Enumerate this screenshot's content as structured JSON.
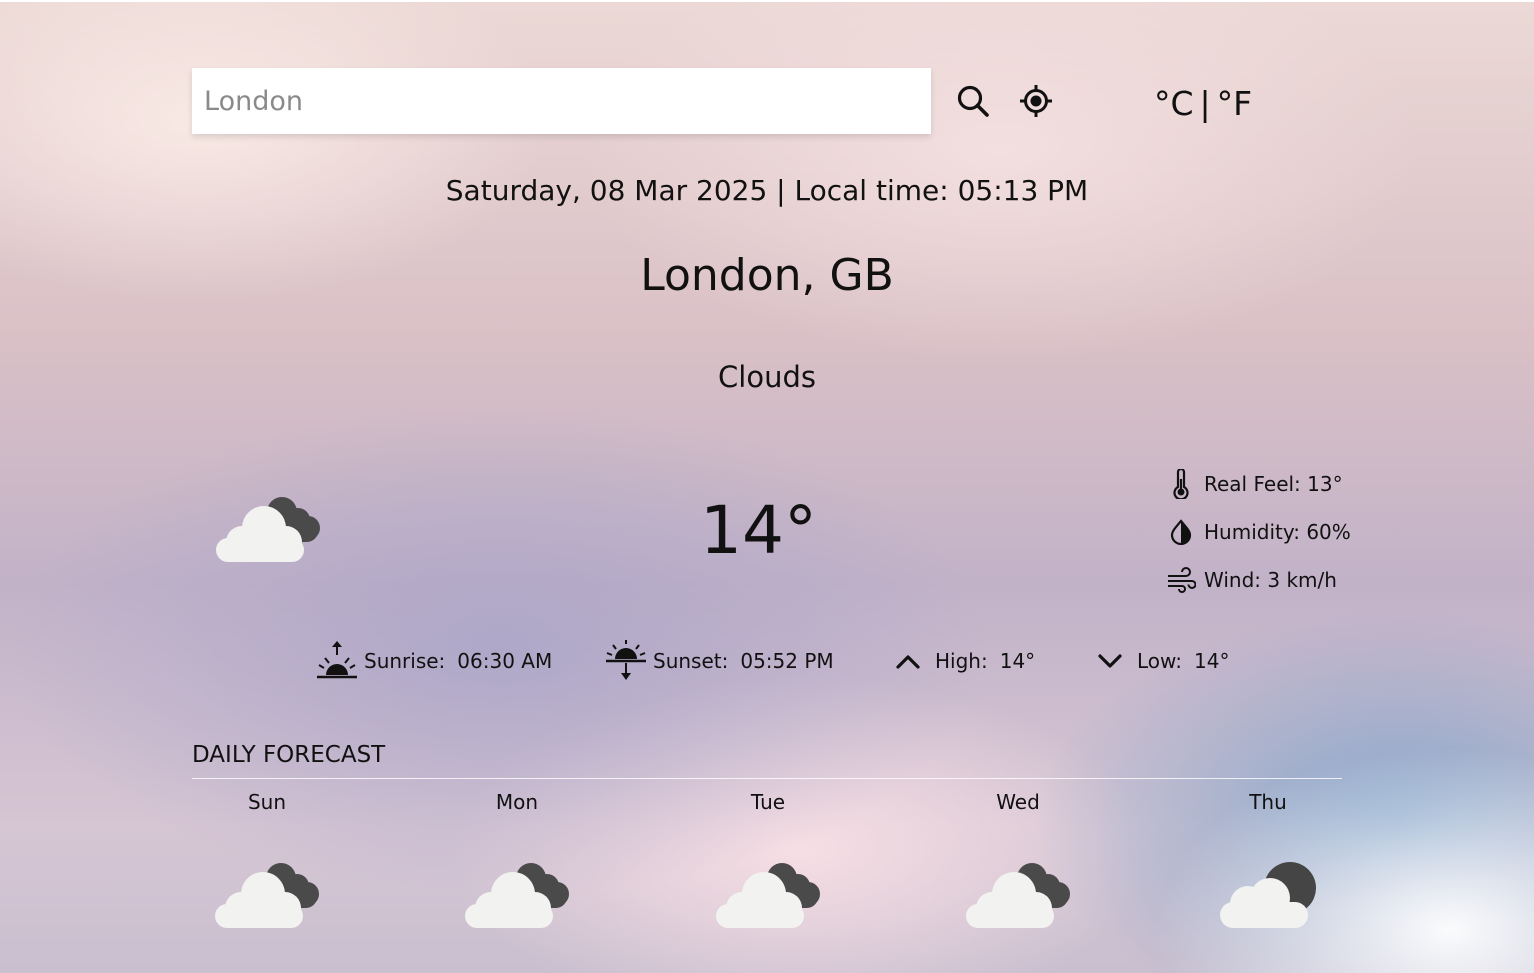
{
  "search": {
    "placeholder": "London",
    "value": ""
  },
  "units": {
    "celsius": "°C",
    "separator": "|",
    "fahrenheit": "°F"
  },
  "datetime": "Saturday, 08 Mar 2025 | Local time: 05:13 PM",
  "location": "London, GB",
  "condition": "Clouds",
  "current": {
    "temperature": "14°",
    "icon": "broken-clouds-icon",
    "details": [
      {
        "icon": "thermometer-icon",
        "label": "Real Feel: 13°"
      },
      {
        "icon": "humidity-icon",
        "label": "Humidity: 60%"
      },
      {
        "icon": "wind-icon",
        "label": "Wind: 3 km/h"
      }
    ]
  },
  "sun": [
    {
      "icon": "sunrise-icon",
      "label": "Sunrise:",
      "value": "06:30 AM"
    },
    {
      "icon": "sunset-icon",
      "label": "Sunset:",
      "value": "05:52 PM"
    },
    {
      "icon": "arrow-up-icon",
      "label": "High:",
      "value": "14°"
    },
    {
      "icon": "arrow-down-icon",
      "label": "Low:",
      "value": "14°"
    }
  ],
  "forecast": {
    "title": "DAILY FORECAST",
    "days": [
      {
        "day": "Sun",
        "icon": "broken-clouds-icon"
      },
      {
        "day": "Mon",
        "icon": "broken-clouds-icon"
      },
      {
        "day": "Tue",
        "icon": "broken-clouds-icon"
      },
      {
        "day": "Wed",
        "icon": "broken-clouds-icon"
      },
      {
        "day": "Thu",
        "icon": "cloudy-night-icon"
      }
    ]
  },
  "colors": {
    "text": "#111111",
    "cloud_light": "#f2f2f0",
    "cloud_dark": "#4a4a4a"
  }
}
